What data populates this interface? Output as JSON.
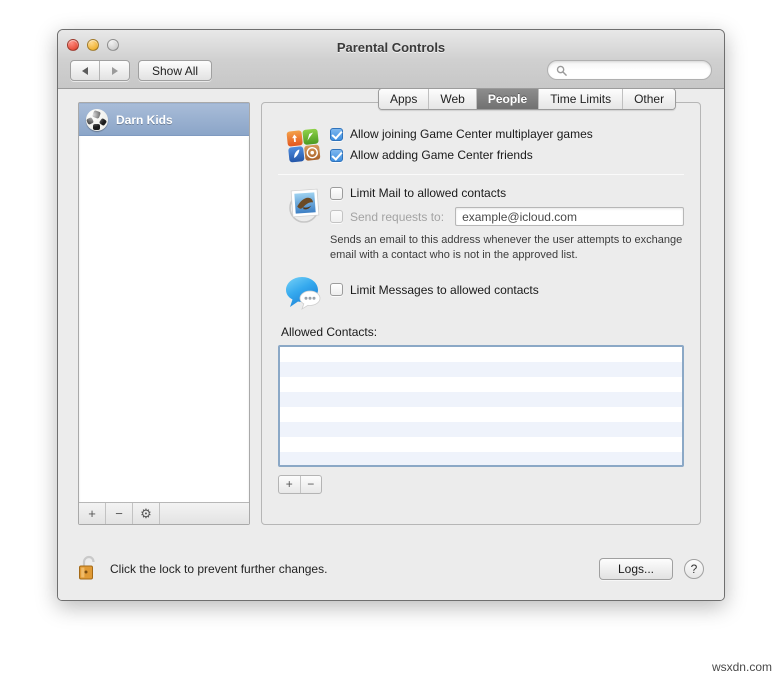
{
  "window": {
    "title": "Parental Controls",
    "traffic_lights": [
      "close",
      "minimize",
      "zoom"
    ]
  },
  "toolbar": {
    "back_label": "Back",
    "forward_label": "Forward",
    "show_all_label": "Show All",
    "search_placeholder": "",
    "search_value": "",
    "search_icon": "search-icon"
  },
  "sidebar": {
    "users": [
      {
        "name": "Darn Kids",
        "selected": true,
        "avatar": "soccer-ball-avatar"
      }
    ],
    "footer_buttons": [
      {
        "label": "+",
        "name": "add-user-button"
      },
      {
        "label": "−",
        "name": "remove-user-button"
      },
      {
        "label": "⚙",
        "name": "settings-gear-button"
      }
    ]
  },
  "tabs": [
    {
      "label": "Apps",
      "active": false
    },
    {
      "label": "Web",
      "active": false
    },
    {
      "label": "People",
      "active": true
    },
    {
      "label": "Time Limits",
      "active": false
    },
    {
      "label": "Other",
      "active": false
    }
  ],
  "people": {
    "game_center": {
      "icon": "game-center-icon",
      "options": [
        {
          "label": "Allow joining Game Center multiplayer games",
          "checked": true,
          "disabled": false
        },
        {
          "label": "Allow adding Game Center friends",
          "checked": true,
          "disabled": false
        }
      ]
    },
    "mail": {
      "icon": "mail-icon",
      "limit_label": "Limit Mail to allowed contacts",
      "limit_checked": false,
      "send_requests_label": "Send requests to:",
      "send_requests_checked": false,
      "send_requests_disabled": true,
      "email_value": "example@icloud.com",
      "help_text": "Sends an email to this address whenever the user attempts to exchange email with a contact who is not in the approved list."
    },
    "messages": {
      "icon": "messages-icon",
      "limit_label": "Limit Messages to allowed contacts",
      "limit_checked": false
    },
    "allowed_contacts": {
      "label": "Allowed Contacts:",
      "entries": [],
      "row_count": 8,
      "add_label": "+",
      "remove_label": "−"
    }
  },
  "bottom": {
    "lock_icon": "unlocked-padlock-icon",
    "lock_text": "Click the lock to prevent further changes.",
    "logs_label": "Logs...",
    "help_label": "?"
  },
  "watermark": "wsxdn.com",
  "colors": {
    "accent": "#3e8fe0",
    "selection": "#8ba5c8",
    "window_bg": "#ececec",
    "stripe": "#eff3fb"
  }
}
